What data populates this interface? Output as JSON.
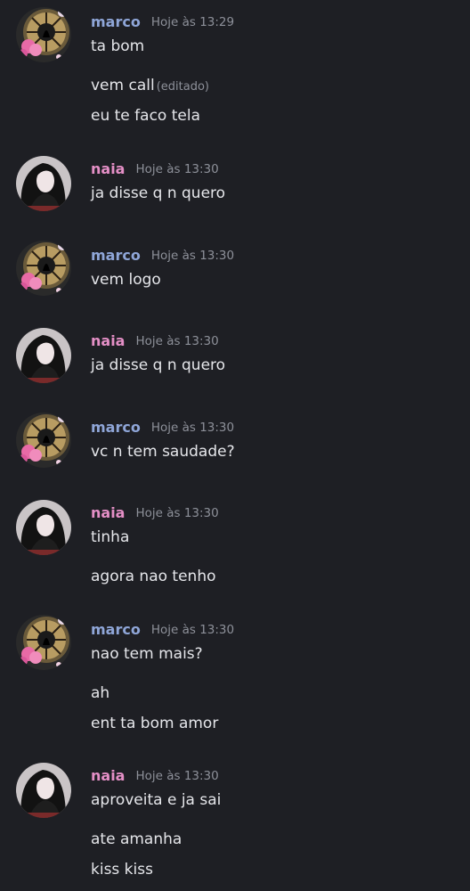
{
  "messages": [
    {
      "author": "marco",
      "time": "Hoje às 13:29",
      "lines": [
        "ta bom",
        "vem call",
        "eu te faco tela"
      ],
      "edited_label": "(editado)"
    },
    {
      "author": "naia",
      "time": "Hoje às 13:30",
      "lines": [
        "ja disse q n quero"
      ]
    },
    {
      "author": "marco",
      "time": "Hoje às 13:30",
      "lines": [
        "vem logo"
      ]
    },
    {
      "author": "naia",
      "time": "Hoje às 13:30",
      "lines": [
        "ja disse q n quero"
      ]
    },
    {
      "author": "marco",
      "time": "Hoje às 13:30",
      "lines": [
        "vc n tem saudade?"
      ]
    },
    {
      "author": "naia",
      "time": "Hoje às 13:30",
      "lines": [
        "tinha",
        "agora nao tenho"
      ]
    },
    {
      "author": "marco",
      "time": "Hoje às 13:30",
      "lines": [
        "nao tem mais?",
        "ah",
        "ent ta bom amor"
      ]
    },
    {
      "author": "naia",
      "time": "Hoje às 13:30",
      "lines": [
        "aproveita e ja sai",
        "ate amanha",
        "kiss kiss"
      ]
    }
  ],
  "colors": {
    "background": "#1e1f24",
    "marco_name": "#8fa6d8",
    "naia_name": "#e48fc6",
    "text": "#e5e6ea",
    "muted": "#8d9099"
  }
}
